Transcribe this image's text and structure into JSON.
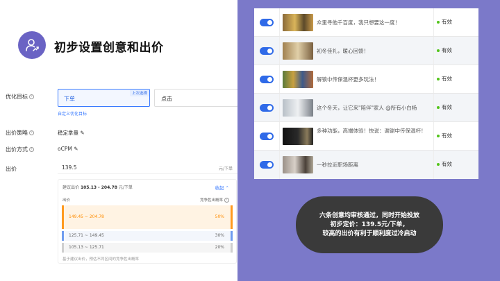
{
  "header": {
    "title": "初步设置创意和出价"
  },
  "form": {
    "goal_label": "优化目标",
    "goal_options": [
      {
        "label": "下单",
        "tag": "上次选择"
      },
      {
        "label": "点击"
      }
    ],
    "custom_goal_link": "自定义优化目标",
    "strategy_label": "出价策略",
    "strategy_value": "稳定拿量",
    "method_label": "出价方式",
    "method_value": "oCPM",
    "price_label": "出价",
    "price_value": "139.5",
    "price_unit": "元/下单"
  },
  "suggestion": {
    "label": "建议出价",
    "range": "105.13 - 204.78",
    "unit": "元/下单",
    "collapse": "收起",
    "col_bid": "出价",
    "col_rate": "竞争胜出概率",
    "bands": [
      {
        "range": "149.45 ~ 204.78",
        "rate": "50%"
      },
      {
        "range": "125.71 ~ 149.45",
        "rate": "30%"
      },
      {
        "range": "105.13 ~ 125.71",
        "rate": "20%"
      }
    ],
    "footnote": "基于建议出价，预估不同区间的竞争胜出概率"
  },
  "creatives": [
    {
      "text": "众里寻他千百度，我只想要这一度！",
      "status": "有效"
    },
    {
      "text": "初冬佳礼，暖心回馈！",
      "status": "有效"
    },
    {
      "text": "解锁中传保温杯更多玩法！",
      "status": "有效"
    },
    {
      "text": "这个冬天，让它来\"陪伴\"家人 @所有小白杨",
      "status": "有效"
    },
    {
      "text": "多种功能，高端体验！快说：谢谢中传保温杯！",
      "status": "有效"
    },
    {
      "text": "一秒拉近职场距离",
      "status": "有效"
    }
  ],
  "callout": {
    "line1": "六条创意均审核通过，同时开始投放",
    "line2": "初步定价：139.5元/下单，",
    "line3": "较高的出价有利于顺利度过冷启动"
  },
  "colors": {
    "accent": "#6a63c4",
    "brand_blue": "#2f6ae8",
    "panel_bg": "#7b79c9",
    "orange": "#ff9a1f",
    "valid_green": "#52c41a"
  }
}
